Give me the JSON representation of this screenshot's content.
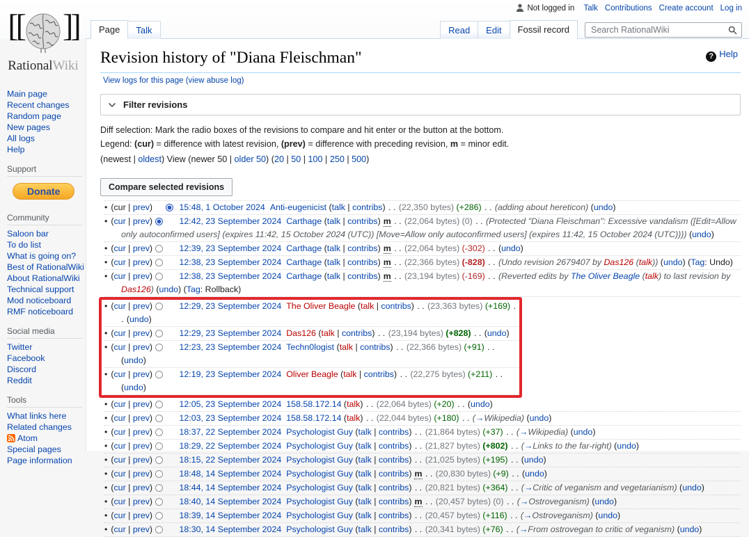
{
  "personal_bar": {
    "not_logged_in": "Not logged in",
    "links": [
      "Talk",
      "Contributions",
      "Create account",
      "Log in"
    ]
  },
  "logo": {
    "part1": "Rational",
    "part2": "Wiki",
    "bracket_left": "[[",
    "bracket_right": "]]"
  },
  "tabs_left": [
    {
      "label": "Page",
      "active": true
    },
    {
      "label": "Talk",
      "active": false
    }
  ],
  "tabs_right": [
    {
      "label": "Read",
      "active": false
    },
    {
      "label": "Edit",
      "active": false
    },
    {
      "label": "Fossil record",
      "active": true
    }
  ],
  "search": {
    "placeholder": "Search RationalWiki"
  },
  "sidebar": {
    "nav": [
      "Main page",
      "Recent changes",
      "Random page",
      "New pages",
      "All logs",
      "Help"
    ],
    "sections": [
      {
        "header": "Support",
        "donate": "Donate",
        "items": []
      },
      {
        "header": "Community",
        "items": [
          "Saloon bar",
          "To do list",
          "What is going on?",
          "Best of RationalWiki",
          "About RationalWiki",
          "Technical support",
          "Mod noticeboard",
          "RMF noticeboard"
        ]
      },
      {
        "header": "Social media",
        "items": [
          "Twitter",
          "Facebook",
          "Discord",
          "Reddit"
        ]
      },
      {
        "header": "Tools",
        "items": [
          "What links here",
          "Related changes",
          {
            "label": "Atom",
            "icon": "rss"
          },
          "Special pages",
          "Page information"
        ]
      }
    ]
  },
  "page": {
    "title": "Revision history of \"Diana Fleischman\"",
    "help_label": "Help",
    "view_logs": "View logs for this page",
    "abuse_log": "view abuse log",
    "filter_label": "Filter revisions",
    "diff_selection": "Diff selection: Mark the radio boxes of the revisions to compare and hit enter or the button at the bottom.",
    "legend": {
      "prefix": "Legend: ",
      "cur": "(cur)",
      "t1": " = difference with latest revision, ",
      "prev": "(prev)",
      "t2": " = difference with preceding revision, ",
      "m": "m",
      "t3": " = minor edit."
    },
    "pager": {
      "p1": "(newest | ",
      "oldest": "oldest",
      "p2": ") View (newer 50 | ",
      "older": "older 50",
      "p3": ") (",
      "counts": [
        "20",
        "50",
        "100",
        "250",
        "500"
      ],
      "sep": " | ",
      "p4": ")"
    },
    "compare_button": "Compare selected revisions"
  },
  "labels": {
    "cur": "cur",
    "prev": "prev",
    "talk": "talk",
    "contribs": "contribs",
    "minor": "m",
    "bytes": "bytes",
    "undo": "undo",
    "tag": "Tag"
  },
  "revisions": [
    {
      "radio": "c2",
      "curlink": false,
      "date": "15:48, 1 October 2024",
      "user": "Anti-eugenicist",
      "uc": "b",
      "tc": "b",
      "ip": false,
      "m": false,
      "bytes": "22,350",
      "diff": "+286",
      "dc": "pos",
      "db": false,
      "comment": [
        {
          "t": "(adding about hereticon)",
          "c": "p"
        }
      ],
      "section": null,
      "undo": true,
      "tag": null,
      "hl": false
    },
    {
      "radio": "c1",
      "curlink": true,
      "date": "12:42, 23 September 2024",
      "user": "Carthage",
      "uc": "b",
      "tc": "b",
      "ip": false,
      "m": true,
      "bytes": "22,064",
      "diff": "0",
      "dc": "zero",
      "db": false,
      "comment": [
        {
          "t": "(Protected \"Diana Fleischman\": Excessive vandalism ([Edit=Allow only autoconfirmed users] (expires 11:42, 15 October 2024 (UTC)) [Move=Allow only autoconfirmed users] (expires 11:42, 15 October 2024 (UTC))))",
          "c": "p"
        }
      ],
      "section": null,
      "undo": true,
      "tag": null,
      "hl": false
    },
    {
      "radio": "u",
      "curlink": true,
      "date": "12:39, 23 September 2024",
      "user": "Carthage",
      "uc": "b",
      "tc": "b",
      "ip": false,
      "m": true,
      "bytes": "22,064",
      "diff": "-302",
      "dc": "neg",
      "db": false,
      "comment": null,
      "section": null,
      "undo": true,
      "tag": null,
      "hl": false
    },
    {
      "radio": "u",
      "curlink": true,
      "date": "12:38, 23 September 2024",
      "user": "Carthage",
      "uc": "b",
      "tc": "b",
      "ip": false,
      "m": true,
      "bytes": "22,366",
      "diff": "-828",
      "dc": "neg",
      "db": true,
      "comment": [
        {
          "t": "(Undo revision 2679407 by ",
          "c": "p"
        },
        {
          "t": "Das126",
          "c": "lr"
        },
        {
          "t": " (",
          "c": "p"
        },
        {
          "t": "talk",
          "c": "lr"
        },
        {
          "t": "))",
          "c": "p"
        }
      ],
      "section": null,
      "undo": true,
      "tag": "Undo",
      "hl": false
    },
    {
      "radio": "u",
      "curlink": true,
      "date": "12:38, 23 September 2024",
      "user": "Carthage",
      "uc": "b",
      "tc": "b",
      "ip": false,
      "m": true,
      "bytes": "23,194",
      "diff": "-169",
      "dc": "neg",
      "db": false,
      "comment": [
        {
          "t": "(Reverted edits by ",
          "c": "p"
        },
        {
          "t": "The Oliver Beagle",
          "c": "lb"
        },
        {
          "t": " (",
          "c": "p"
        },
        {
          "t": "talk",
          "c": "lr"
        },
        {
          "t": ") to last revision by ",
          "c": "p"
        },
        {
          "t": "Das126",
          "c": "lr"
        },
        {
          "t": ")",
          "c": "p"
        }
      ],
      "section": null,
      "undo": true,
      "tag": "Rollback",
      "hl": false
    },
    {
      "radio": "u",
      "curlink": true,
      "date": "12:29, 23 September 2024",
      "user": "The Oliver Beagle",
      "uc": "r",
      "tc": "r",
      "ip": false,
      "m": false,
      "bytes": "23,363",
      "diff": "+169",
      "dc": "pos",
      "db": false,
      "comment": null,
      "section": null,
      "undo": true,
      "tag": null,
      "hl": true
    },
    {
      "radio": "u",
      "curlink": true,
      "date": "12:29, 23 September 2024",
      "user": "Das126",
      "uc": "r",
      "tc": "r",
      "ip": false,
      "m": false,
      "bytes": "23,194",
      "diff": "+828",
      "dc": "pos",
      "db": true,
      "comment": null,
      "section": null,
      "undo": true,
      "tag": null,
      "hl": true
    },
    {
      "radio": "u",
      "curlink": true,
      "date": "12:23, 23 September 2024",
      "user": "Techn0logist",
      "uc": "b",
      "tc": "r",
      "ip": false,
      "m": false,
      "bytes": "22,366",
      "diff": "+91",
      "dc": "pos",
      "db": false,
      "comment": null,
      "section": null,
      "undo": true,
      "tag": null,
      "hl": true
    },
    {
      "radio": "u",
      "curlink": true,
      "date": "12:19, 23 September 2024",
      "user": "Oliver Beagle",
      "uc": "r",
      "tc": "r",
      "ip": false,
      "m": false,
      "bytes": "22,275",
      "diff": "+211",
      "dc": "pos",
      "db": false,
      "comment": null,
      "section": null,
      "undo": true,
      "tag": null,
      "hl": true
    },
    {
      "radio": "u",
      "curlink": true,
      "date": "12:05, 23 September 2024",
      "user": "158.58.172.14",
      "uc": "b",
      "tc": "r",
      "ip": true,
      "m": false,
      "bytes": "22,064",
      "diff": "+20",
      "dc": "pos",
      "db": false,
      "comment": null,
      "section": null,
      "undo": true,
      "tag": null,
      "hl": false
    },
    {
      "radio": "u",
      "curlink": true,
      "date": "12:03, 23 September 2024",
      "user": "158.58.172.14",
      "uc": "b",
      "tc": "r",
      "ip": true,
      "m": false,
      "bytes": "22,044",
      "diff": "+180",
      "dc": "pos",
      "db": false,
      "comment": null,
      "section": "Wikipedia",
      "undo": true,
      "tag": null,
      "hl": false
    },
    {
      "radio": "u",
      "curlink": true,
      "date": "18:37, 22 September 2024",
      "user": "Psychologist Guy",
      "uc": "b",
      "tc": "b",
      "ip": false,
      "m": false,
      "bytes": "21,864",
      "diff": "+37",
      "dc": "pos",
      "db": false,
      "comment": null,
      "section": "Wikipedia",
      "undo": true,
      "tag": null,
      "hl": false
    },
    {
      "radio": "u",
      "curlink": true,
      "date": "18:29, 22 September 2024",
      "user": "Psychologist Guy",
      "uc": "b",
      "tc": "b",
      "ip": false,
      "m": false,
      "bytes": "21,827",
      "diff": "+802",
      "dc": "pos",
      "db": true,
      "comment": null,
      "section": "Links to the far-right",
      "undo": true,
      "tag": null,
      "hl": false
    },
    {
      "radio": "u",
      "curlink": true,
      "date": "18:15, 22 September 2024",
      "user": "Psychologist Guy",
      "uc": "b",
      "tc": "b",
      "ip": false,
      "m": false,
      "bytes": "21,025",
      "diff": "+195",
      "dc": "pos",
      "db": false,
      "comment": null,
      "section": null,
      "undo": true,
      "tag": null,
      "hl": false
    },
    {
      "radio": "u",
      "curlink": true,
      "date": "18:48, 14 September 2024",
      "user": "Psychologist Guy",
      "uc": "b",
      "tc": "b",
      "ip": false,
      "m": true,
      "bytes": "20,830",
      "diff": "+9",
      "dc": "pos",
      "db": false,
      "comment": null,
      "section": null,
      "undo": true,
      "tag": null,
      "hl": false
    },
    {
      "radio": "u",
      "curlink": true,
      "date": "18:44, 14 September 2024",
      "user": "Psychologist Guy",
      "uc": "b",
      "tc": "b",
      "ip": false,
      "m": false,
      "bytes": "20,821",
      "diff": "+364",
      "dc": "pos",
      "db": false,
      "comment": null,
      "section": "Critic of veganism and vegetarianism",
      "undo": true,
      "tag": null,
      "hl": false
    },
    {
      "radio": "u",
      "curlink": true,
      "date": "18:40, 14 September 2024",
      "user": "Psychologist Guy",
      "uc": "b",
      "tc": "b",
      "ip": false,
      "m": true,
      "bytes": "20,457",
      "diff": "0",
      "dc": "zero",
      "db": false,
      "comment": null,
      "section": "Ostroveganism",
      "undo": true,
      "tag": null,
      "hl": false
    },
    {
      "radio": "u",
      "curlink": true,
      "date": "18:39, 14 September 2024",
      "user": "Psychologist Guy",
      "uc": "b",
      "tc": "b",
      "ip": false,
      "m": false,
      "bytes": "20,457",
      "diff": "+116",
      "dc": "pos",
      "db": false,
      "comment": null,
      "section": "Ostroveganism",
      "undo": true,
      "tag": null,
      "hl": false
    },
    {
      "radio": "u",
      "curlink": true,
      "date": "18:30, 14 September 2024",
      "user": "Psychologist Guy",
      "uc": "b",
      "tc": "b",
      "ip": false,
      "m": false,
      "bytes": "20,341",
      "diff": "+76",
      "dc": "pos",
      "db": false,
      "comment": null,
      "section": "From ostrovegan to critic of veganism",
      "undo": true,
      "tag": null,
      "hl": false
    }
  ]
}
